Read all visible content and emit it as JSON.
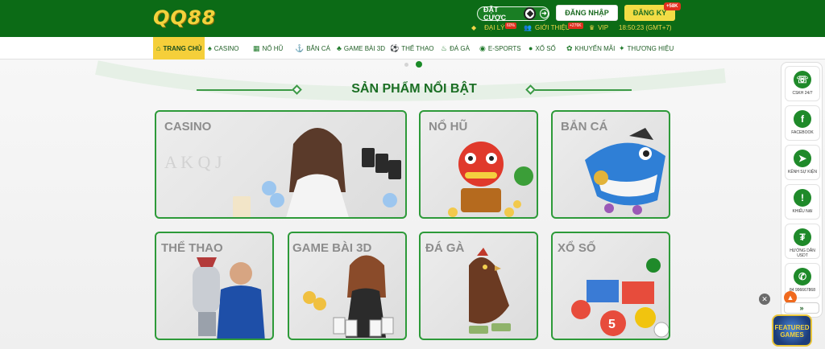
{
  "header": {
    "logo": "QQ88",
    "bet_label": "ĐẶT CƯỢC",
    "login_label": "ĐĂNG NHẬP",
    "register_label": "ĐĂNG KÝ",
    "register_badge": "+58K",
    "agent_label": "ĐẠI LÝ",
    "agent_badge": "60%",
    "refer_label": "GIỚI THIỆU",
    "refer_badge": "+276K",
    "vip_label": "VIP",
    "clock": "18:50:23 (GMT+7)",
    "colors": {
      "brand_green": "#0c6b16",
      "accent_yellow": "#f2dc45"
    }
  },
  "nav": {
    "items": [
      {
        "label": "TRANG CHỦ",
        "icon": "home-icon"
      },
      {
        "label": "CASINO",
        "icon": "casino-icon"
      },
      {
        "label": "NỔ HŨ",
        "icon": "slot-icon"
      },
      {
        "label": "BẮN CÁ",
        "icon": "fish-icon"
      },
      {
        "label": "GAME BÀI 3D",
        "icon": "cards-icon"
      },
      {
        "label": "THỂ THAO",
        "icon": "sport-icon"
      },
      {
        "label": "ĐÁ GÀ",
        "icon": "rooster-icon"
      },
      {
        "label": "E-SPORTS",
        "icon": "gamepad-icon"
      },
      {
        "label": "XỔ SỐ",
        "icon": "lottery-icon"
      },
      {
        "label": "KHUYẾN MÃI",
        "icon": "gift-icon"
      },
      {
        "label": "THƯƠNG HIỆU",
        "icon": "brand-icon"
      }
    ]
  },
  "section": {
    "title": "SẢN PHẨM NỔI BẬT",
    "cards": [
      {
        "label": "CASINO"
      },
      {
        "label": "NỔ HŨ"
      },
      {
        "label": "BẮN CÁ"
      },
      {
        "label": "THỂ THAO"
      },
      {
        "label": "GAME BÀI 3D"
      },
      {
        "label": "ĐÁ GÀ"
      },
      {
        "label": "XỔ SỐ"
      }
    ]
  },
  "side": {
    "items": [
      {
        "label": "CSKH 24/7",
        "icon": "headset-icon"
      },
      {
        "label": "FACEBOOK",
        "icon": "facebook-icon"
      },
      {
        "label": "KÊNH SỰ KIỆN",
        "icon": "telegram-icon"
      },
      {
        "label": "KHIẾU NẠI",
        "icon": "complaint-icon"
      },
      {
        "label": "HƯỚNG DẪN USDT",
        "icon": "usdt-icon"
      },
      {
        "label": "84 996667868",
        "icon": "phone-icon"
      }
    ],
    "more": "»",
    "games_logo": "FEATURED GAMES"
  }
}
